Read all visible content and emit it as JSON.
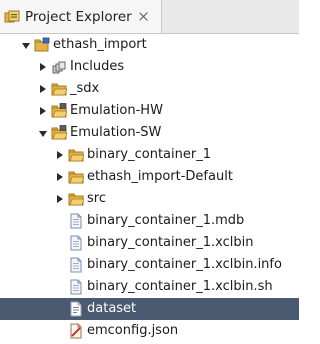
{
  "tab": {
    "title": "Project Explorer",
    "icon": "project-explorer-icon",
    "close_icon": "close-icon"
  },
  "colors": {
    "folder": "#e7b243",
    "selection": "#4a5a70",
    "tab_bg": "#f6f6f6"
  },
  "tree": {
    "items": [
      {
        "label": "ethash_import",
        "depth": 0,
        "state": "open",
        "icon": "project-folder-icon"
      },
      {
        "label": "Includes",
        "depth": 1,
        "state": "closed",
        "icon": "includes-icon"
      },
      {
        "label": "_sdx",
        "depth": 1,
        "state": "closed",
        "icon": "folder-icon"
      },
      {
        "label": "Emulation-HW",
        "depth": 1,
        "state": "closed",
        "icon": "build-folder-icon"
      },
      {
        "label": "Emulation-SW",
        "depth": 1,
        "state": "open",
        "icon": "build-folder-icon"
      },
      {
        "label": "binary_container_1",
        "depth": 2,
        "state": "closed",
        "icon": "folder-icon"
      },
      {
        "label": "ethash_import-Default",
        "depth": 2,
        "state": "closed",
        "icon": "folder-icon"
      },
      {
        "label": "src",
        "depth": 2,
        "state": "closed",
        "icon": "folder-icon"
      },
      {
        "label": "binary_container_1.mdb",
        "depth": 2,
        "state": "leaf",
        "icon": "file-icon"
      },
      {
        "label": "binary_container_1.xclbin",
        "depth": 2,
        "state": "leaf",
        "icon": "file-icon"
      },
      {
        "label": "binary_container_1.xclbin.info",
        "depth": 2,
        "state": "leaf",
        "icon": "file-icon"
      },
      {
        "label": "binary_container_1.xclbin.sh",
        "depth": 2,
        "state": "leaf",
        "icon": "file-icon"
      },
      {
        "label": "dataset",
        "depth": 2,
        "state": "leaf",
        "icon": "text-file-icon",
        "selected": true
      },
      {
        "label": "emconfig.json",
        "depth": 2,
        "state": "leaf",
        "icon": "json-file-icon"
      }
    ]
  }
}
